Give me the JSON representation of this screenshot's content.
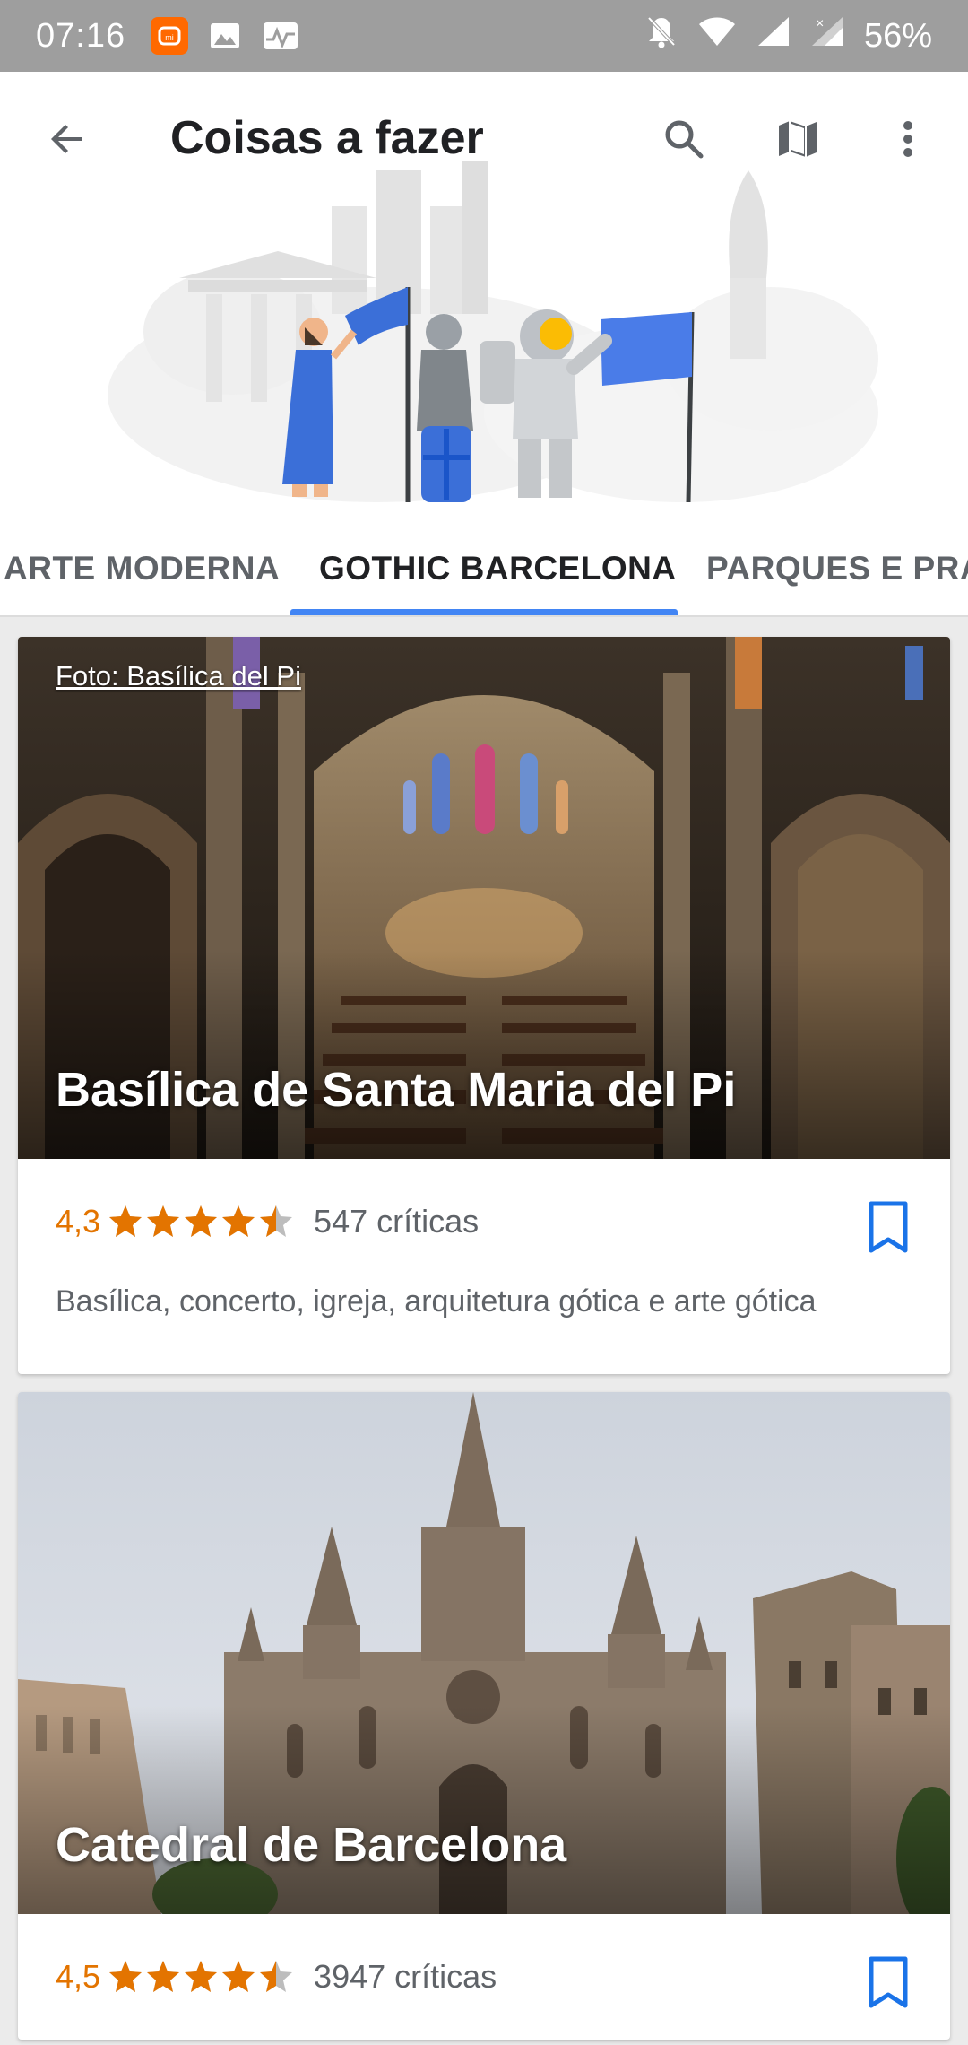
{
  "status_bar": {
    "time": "07:16",
    "battery": "56%",
    "icons": [
      "mi-app-icon",
      "image-icon",
      "activity-icon",
      "mute-icon",
      "wifi-icon",
      "signal-icon",
      "signal-x-icon"
    ]
  },
  "appbar": {
    "title": "Coisas a fazer",
    "icons": [
      "back-arrow-icon",
      "search-icon",
      "map-icon",
      "more-vert-icon"
    ]
  },
  "tabs": [
    {
      "label": "ARTE MODERNA",
      "active": false
    },
    {
      "label": "GOTHIC BARCELONA",
      "active": true
    },
    {
      "label": "PARQUES E PRAÇ",
      "active": false
    }
  ],
  "colors": {
    "accent": "#4285f4",
    "rating": "#e37400",
    "bookmark": "#1a73e8",
    "status_bar": "#9e9e9e"
  },
  "places": [
    {
      "photo_credit": "Foto: Basílica del Pi",
      "name": "Basílica de Santa Maria del Pi",
      "rating": "4,3",
      "stars": 4.3,
      "reviews": "547 críticas",
      "categories": "Basílica, concerto, igreja, arquitetura gótica e arte gótica"
    },
    {
      "photo_credit": "",
      "name": "Catedral de Barcelona",
      "rating": "4,5",
      "stars": 4.5,
      "reviews": "3947 críticas",
      "categories": ""
    }
  ]
}
